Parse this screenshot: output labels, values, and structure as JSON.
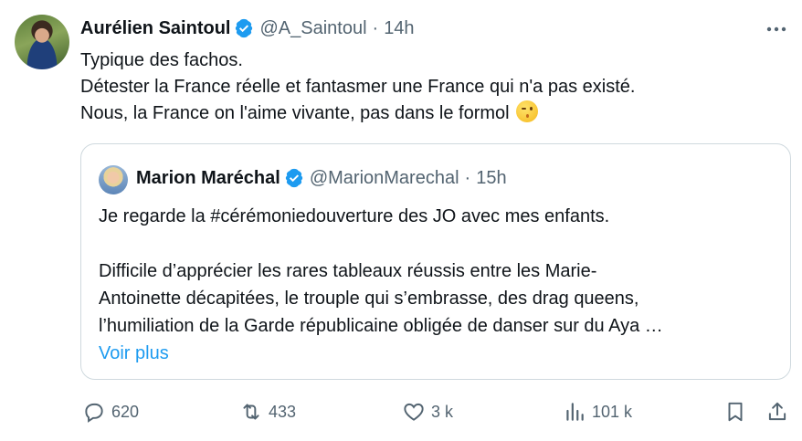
{
  "author": {
    "name": "Aurélien Saintoul",
    "handle": "@A_Saintoul",
    "time": "14h"
  },
  "tweet": {
    "lines": [
      "Typique des fachos.",
      "Détester la France réelle et fantasmer une France qui n'a pas existé.",
      "Nous, la France on l'aime vivante, pas dans le formol"
    ],
    "emoji": "winking-face"
  },
  "quoted": {
    "name": "Marion Maréchal",
    "handle": "@MarionMarechal",
    "time": "15h",
    "lines": [
      "Je regarde la #cérémoniedouverture des JO avec mes enfants.",
      "",
      "Difficile d’apprécier les rares tableaux réussis entre les Marie-",
      "Antoinette décapitées, le trouple qui s’embrasse, des drag queens,",
      "l’humiliation de la Garde républicaine obligée de danser sur du Aya …"
    ],
    "show_more": "Voir plus"
  },
  "actions": {
    "replies": "620",
    "reposts": "433",
    "likes": "3 k",
    "views": "101 k"
  },
  "colors": {
    "text": "#0f1419",
    "muted": "#536471",
    "accent": "#1d9bf0",
    "border": "#cfd9de"
  }
}
